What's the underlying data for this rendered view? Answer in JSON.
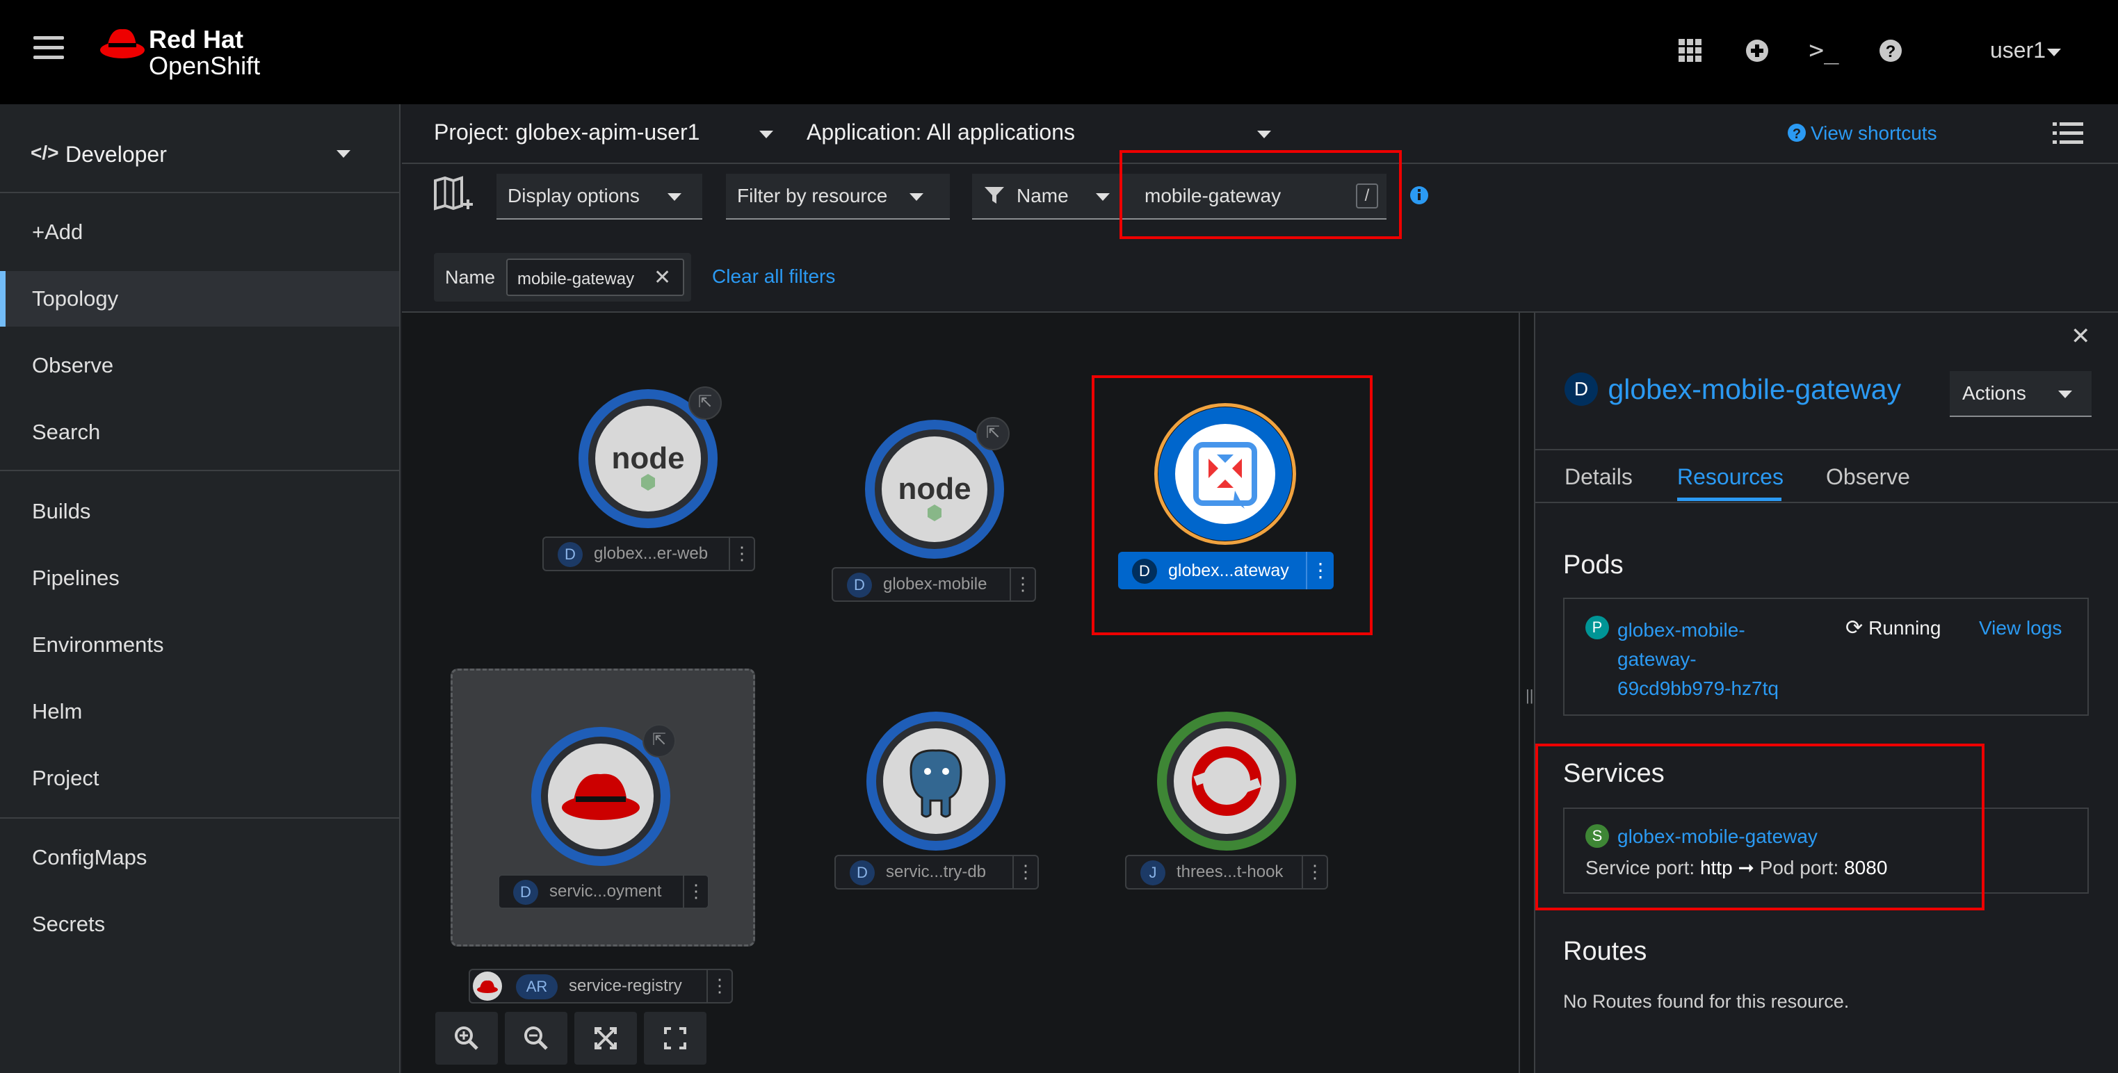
{
  "masthead": {
    "brand_line1": "Red Hat",
    "brand_line2": "OpenShift",
    "user_label": "user1",
    "icons": [
      "grid-icon",
      "plus-circle-icon",
      "terminal-icon",
      "help-icon"
    ]
  },
  "sidebar": {
    "perspective": "Developer",
    "items": [
      "+Add",
      "Topology",
      "Observe",
      "Search",
      "Builds",
      "Pipelines",
      "Environments",
      "Helm",
      "Project",
      "ConfigMaps",
      "Secrets"
    ],
    "active": "Topology"
  },
  "header": {
    "project": "Project: globex-apim-user1",
    "application": "Application: All applications",
    "view_shortcuts": "View shortcuts"
  },
  "toolbar": {
    "display_options": "Display options",
    "filter_by_resource": "Filter by resource",
    "filter_type": "Name",
    "filter_value": "mobile-gateway",
    "filter_shortcut": "/",
    "chip_group_label": "Name",
    "chip_value": "mobile-gateway",
    "clear_filters": "Clear all filters"
  },
  "topology": {
    "nodes": [
      {
        "badge": "D",
        "label": "globex...er-web"
      },
      {
        "badge": "D",
        "label": "globex-mobile"
      },
      {
        "badge": "D",
        "label": "globex...ateway"
      },
      {
        "badge": "D",
        "label": "servic...oyment"
      },
      {
        "badge": "D",
        "label": "servic...try-db"
      },
      {
        "badge": "J",
        "label": "threes...t-hook"
      }
    ],
    "group": {
      "badge": "AR",
      "label": "service-registry"
    }
  },
  "drawer": {
    "badge": "D",
    "title": "globex-mobile-gateway",
    "actions": "Actions",
    "tabs": [
      "Details",
      "Resources",
      "Observe"
    ],
    "active_tab": "Resources",
    "pods_title": "Pods",
    "pod_badge": "P",
    "pod_name_1": "globex-mobile-",
    "pod_name_2": "gateway-",
    "pod_name_3": "69cd9bb979-hz7tq",
    "pod_status": "Running",
    "view_logs": "View logs",
    "services_title": "Services",
    "service_badge": "S",
    "service_name": "globex-mobile-gateway",
    "service_port_label": "Service port:",
    "service_port": "http",
    "pod_port_label": "Pod port:",
    "pod_port": "8080",
    "routes_title": "Routes",
    "routes_empty": "No Routes found for this resource."
  },
  "colors": {
    "accent": "#2b9af3",
    "highlight_box": "#ee0000",
    "selected_node": "#0066cc"
  }
}
